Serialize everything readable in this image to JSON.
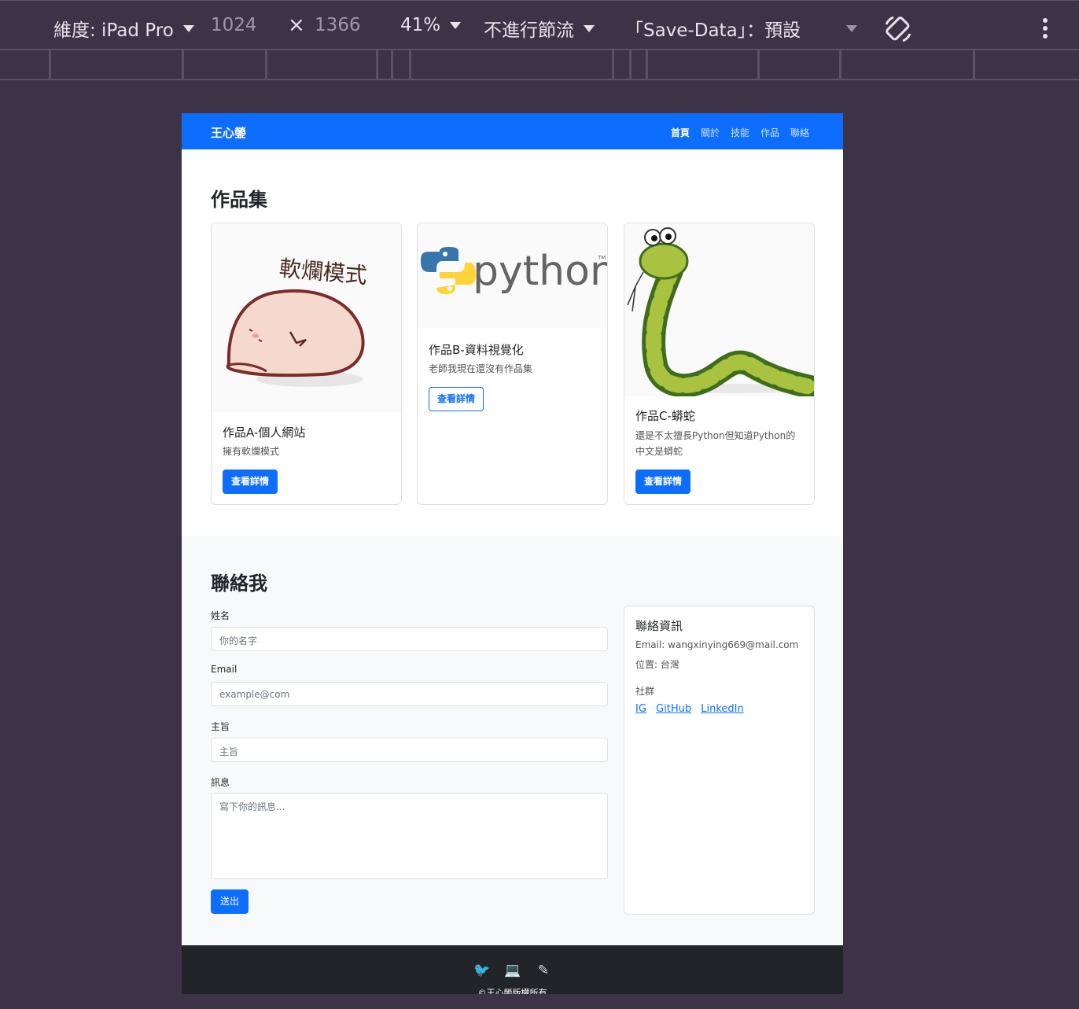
{
  "devtools": {
    "dimension_label": "維度: iPad Pro",
    "width": "1024",
    "times": "×",
    "height": "1366",
    "zoom": "41%",
    "throttle": "不進行節流",
    "save_data": "「Save-Data」：預設"
  },
  "site": {
    "brand": "王心鎣",
    "nav": [
      "首頁",
      "關於",
      "技能",
      "作品",
      "聯絡"
    ]
  },
  "portfolio": {
    "title": "作品集",
    "cards": [
      {
        "image_text": "軟爛模式",
        "title": "作品A-個人網站",
        "text": "擁有軟爛模式",
        "button": "查看詳情"
      },
      {
        "image_text": "python",
        "title": "作品B-資料視覺化",
        "text": "老師我現在還沒有作品集",
        "button": "查看詳情"
      },
      {
        "title": "作品C-蟒蛇",
        "text": "還是不太擅長Python但知道Python的中文是蟒蛇",
        "button": "查看詳情"
      }
    ]
  },
  "contact": {
    "title": "聯絡我",
    "name_label": "姓名",
    "name_placeholder": "你的名字",
    "email_label": "Email",
    "email_placeholder": "example@com",
    "subject_label": "主旨",
    "subject_placeholder": "主旨",
    "message_label": "訊息",
    "message_placeholder": "寫下你的訊息...",
    "submit": "送出",
    "info": {
      "title": "聯絡資訊",
      "email": "Email: wangxinying669@mail.com",
      "location": "位置: 台灣",
      "social_label": "社群",
      "links": [
        "IG",
        "GitHub",
        "LinkedIn"
      ]
    }
  },
  "footer": {
    "icons": [
      "bird-icon",
      "laptop-icon",
      "pen-icon"
    ],
    "copyright": "©王心鎣版權所有"
  },
  "colors": {
    "primary": "#0d6efd",
    "dark": "#212529",
    "devtools_bg": "#3c3446"
  }
}
